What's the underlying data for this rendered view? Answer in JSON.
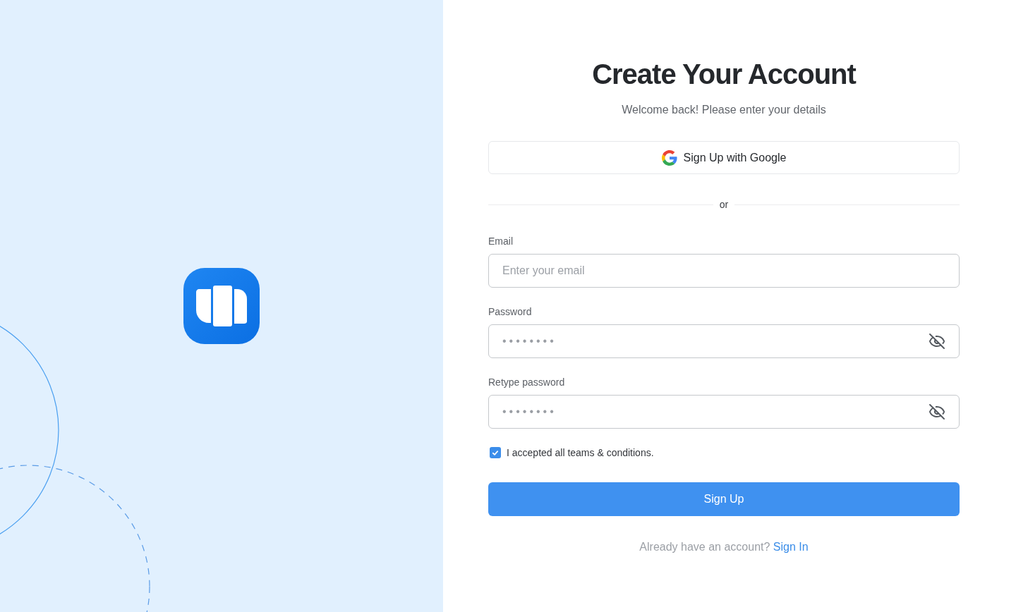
{
  "heading": "Create Your Account",
  "subtitle": "Welcome back! Please enter your details",
  "google_button": {
    "label": "Sign Up with Google"
  },
  "divider": "or",
  "fields": [
    {
      "kind": "email",
      "label": "Email",
      "placeholder": "Enter your email"
    },
    {
      "kind": "password",
      "label": "Password",
      "value": "••••••••"
    },
    {
      "kind": "password",
      "label": "Retype password",
      "value": "••••••••"
    }
  ],
  "terms": {
    "checked": true,
    "label": "I accepted all teams & conditions."
  },
  "submit_button": {
    "label": "Sign Up"
  },
  "footer": {
    "text": "Already have an account?",
    "link": "Sign In"
  }
}
